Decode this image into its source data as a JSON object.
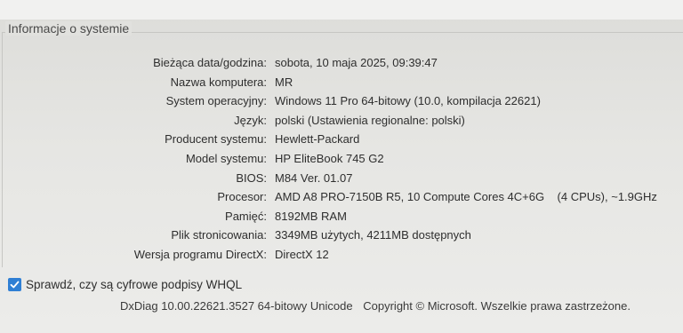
{
  "group": {
    "title": "Informacje o systemie"
  },
  "info_rows": [
    {
      "label": "Bieżąca data/godzina:",
      "value": "sobota, 10 maja 2025, 09:39:47"
    },
    {
      "label": "Nazwa komputera:",
      "value": "MR"
    },
    {
      "label": "System operacyjny:",
      "value": "Windows 11 Pro 64-bitowy (10.0, kompilacja 22621)"
    },
    {
      "label": "Język:",
      "value": "polski (Ustawienia regionalne: polski)"
    },
    {
      "label": "Producent systemu:",
      "value": "Hewlett-Packard"
    },
    {
      "label": "Model systemu:",
      "value": "HP EliteBook 745 G2"
    },
    {
      "label": "BIOS:",
      "value": "M84 Ver. 01.07"
    },
    {
      "label": "Procesor:",
      "value": "AMD A8 PRO-7150B R5, 10 Compute Cores 4C+6G    (4 CPUs), ~1.9GHz"
    },
    {
      "label": "Pamięć:",
      "value": "8192MB RAM"
    },
    {
      "label": "Plik stronicowania:",
      "value": "3349MB użytych, 4211MB dostępnych"
    },
    {
      "label": "Wersja programu DirectX:",
      "value": "DirectX 12"
    }
  ],
  "whql_check": {
    "label": "Sprawdź, czy są cyfrowe podpisy WHQL",
    "checked": true
  },
  "footer": {
    "version": "DxDiag 10.00.22621.3527 64-bitowy Unicode",
    "copyright": "Copyright © Microsoft. Wszelkie prawa zastrzeżone."
  },
  "colors": {
    "checkbox_accent": "#2f7fd4"
  },
  "icons": {
    "checkbox": "check-icon"
  }
}
